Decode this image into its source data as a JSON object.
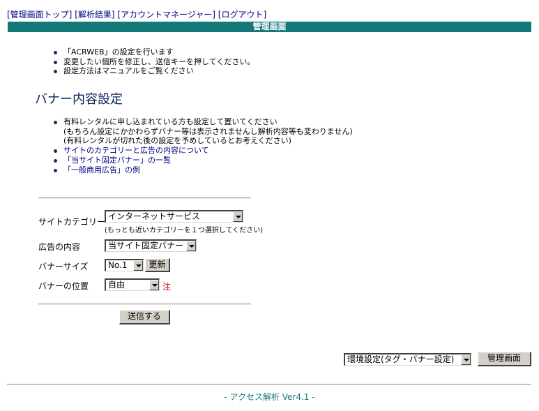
{
  "nav": {
    "top": "[管理画面トップ]",
    "results": "[解析結果]",
    "account": "[アカウントマネージャー]",
    "logout": "[ログアウト]"
  },
  "title_bar": "管理画面",
  "intro": [
    "「ACRWEB」の設定を行います",
    "変更したい個所を修正し、送信キーを押してください。",
    "設定方法はマニュアルをご覧ください"
  ],
  "section_title": "バナー内容設定",
  "notes": {
    "line1": "有料レンタルに申し込まれている方も設定して置いてください",
    "line2": "(もちろん設定にかかわらずバナー等は表示されませんし解析内容等も変わりません)",
    "line3": "(有料レンタルが切れた後の設定を予めしているとお考えください)",
    "link1": "サイトのカテゴリーと広告の内容について",
    "link2": "「当サイト固定バナー」の一覧",
    "link3": "「一般商用広告」の例"
  },
  "form": {
    "category_label": "サイトカテゴリー",
    "category_value": "インターネットサービス",
    "category_hint": "(もっとも近いカテゴリーを１つ選択してください)",
    "ad_label": "広告の内容",
    "ad_value": "当サイト固定バナー",
    "size_label": "バナーサイズ",
    "size_value": "No.1",
    "update_button": "更新",
    "position_label": "バナーの位置",
    "position_value": "自由",
    "position_note": "注",
    "submit_button": "送信する"
  },
  "bottom": {
    "menu_value": "環境設定(タグ・バナー設定)",
    "admin_button": "管理画面"
  },
  "footer": "- アクセス解析 Ver4.1 -",
  "colors": {
    "title_bar_bg": "#147878",
    "link": "#000080",
    "footer_text": "#147878",
    "note_mark": "#cc0000"
  }
}
